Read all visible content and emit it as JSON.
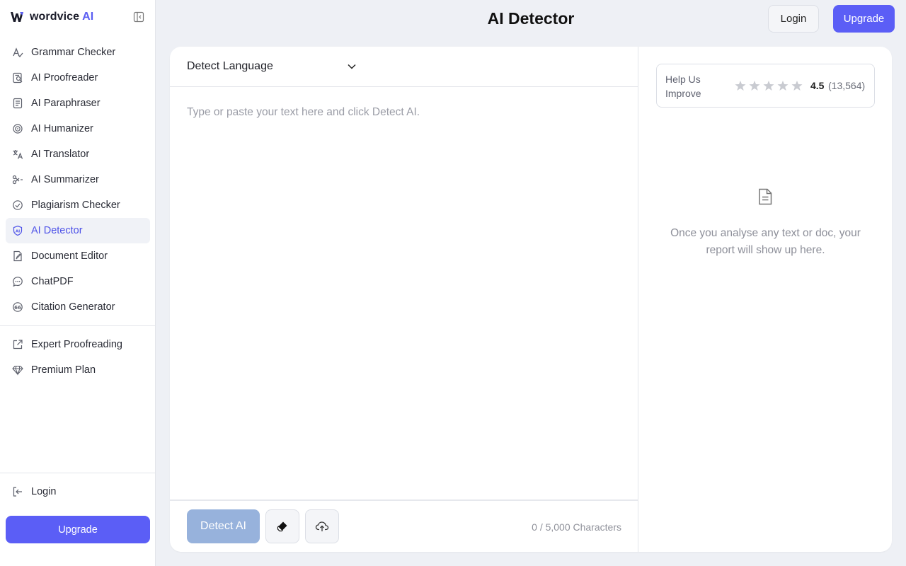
{
  "brand": {
    "name": "wordvice",
    "suffix": "AI",
    "accent": "#5b5ef2"
  },
  "sidebar": {
    "items": [
      {
        "label": "Grammar Checker",
        "icon": "grammar-icon"
      },
      {
        "label": "AI Proofreader",
        "icon": "proofreader-icon"
      },
      {
        "label": "AI Paraphraser",
        "icon": "paraphraser-icon"
      },
      {
        "label": "AI Humanizer",
        "icon": "humanizer-icon"
      },
      {
        "label": "AI Translator",
        "icon": "translator-icon"
      },
      {
        "label": "AI Summarizer",
        "icon": "summarizer-icon"
      },
      {
        "label": "Plagiarism Checker",
        "icon": "plagiarism-icon"
      },
      {
        "label": "AI Detector",
        "icon": "ai-detector-icon",
        "active": true
      },
      {
        "label": "Document Editor",
        "icon": "document-icon"
      },
      {
        "label": "ChatPDF",
        "icon": "chat-icon"
      },
      {
        "label": "Citation Generator",
        "icon": "citation-icon"
      }
    ],
    "secondary": [
      {
        "label": "Expert Proofreading",
        "icon": "external-link-icon"
      },
      {
        "label": "Premium Plan",
        "icon": "diamond-icon"
      }
    ],
    "login_label": "Login",
    "upgrade_label": "Upgrade"
  },
  "header": {
    "title": "AI Detector",
    "login_label": "Login",
    "upgrade_label": "Upgrade"
  },
  "editor": {
    "language_label": "Detect Language",
    "placeholder": "Type or paste your text here and click Detect AI.",
    "value": "",
    "detect_label": "Detect AI",
    "char_count": "0 / 5,000 Characters"
  },
  "report": {
    "rating_label": "Help Us Improve",
    "rating_score": "4.5",
    "rating_count": "(13,564)",
    "stars": 5,
    "empty_message": "Once you analyse any text or doc, your report will show up here."
  },
  "colors": {
    "primary": "#5b5ef6",
    "detect_disabled": "#97b2dc",
    "background": "#eef0f5"
  }
}
